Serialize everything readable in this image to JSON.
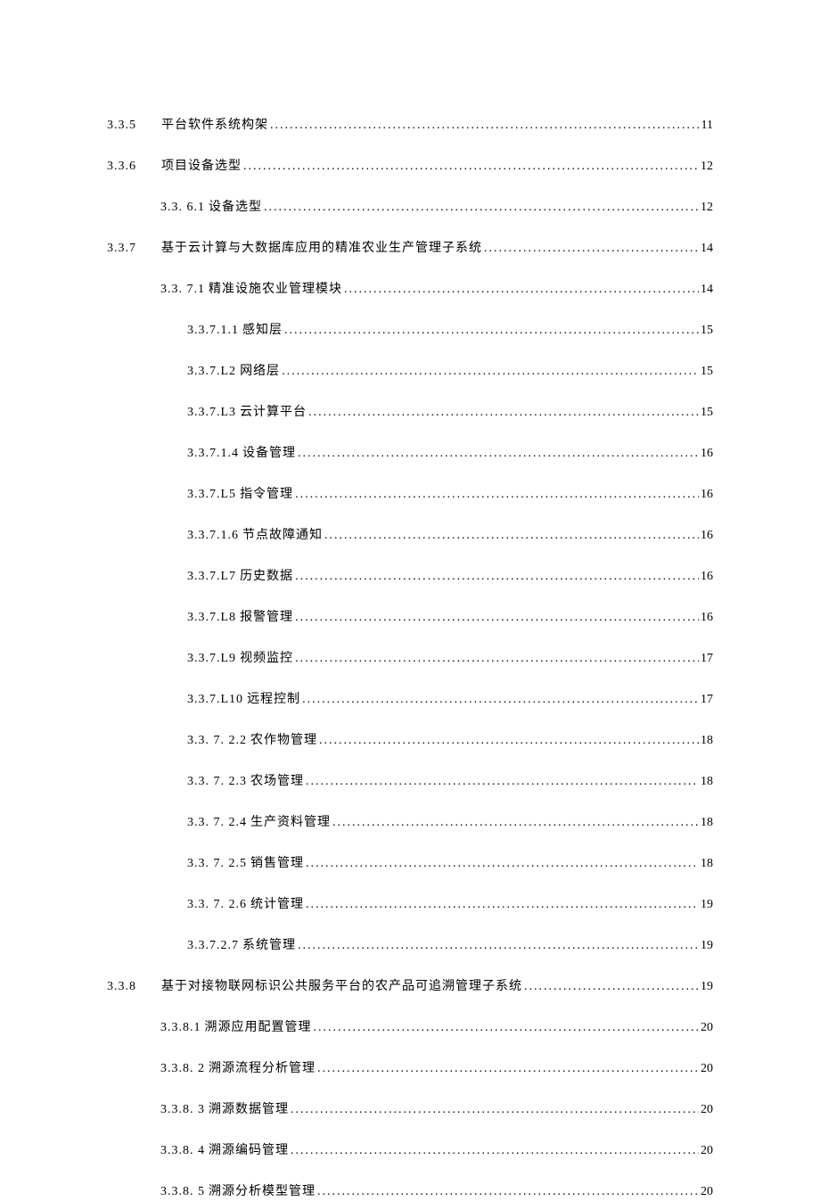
{
  "toc": [
    {
      "indent": 0,
      "number": "3.3.5",
      "numberClass": "gap-after-number",
      "title": "平台软件系统构架",
      "page": "11"
    },
    {
      "indent": 0,
      "number": "3.3.6",
      "numberClass": "gap-after-number",
      "title": "项目设备选型",
      "page": "12"
    },
    {
      "indent": 1,
      "number": "3.3. 6.1",
      "numberClass": "gap-small",
      "title": "设备选型",
      "page": "12"
    },
    {
      "indent": 0,
      "number": "3.3.7",
      "numberClass": "gap-after-number",
      "title": "基于云计算与大数据库应用的精准农业生产管理子系统",
      "page": "14"
    },
    {
      "indent": 1,
      "number": "3.3. 7.1",
      "numberClass": "gap-small",
      "title": "精准设施农业管理模块",
      "page": "14"
    },
    {
      "indent": 2,
      "number": "3.3.7.1.1",
      "numberClass": "gap-small",
      "title": "感知层",
      "page": "15"
    },
    {
      "indent": 2,
      "number": "3.3.7.L2",
      "numberClass": "gap-small",
      "title": "网络层",
      "page": "15"
    },
    {
      "indent": 2,
      "number": "3.3.7.L3",
      "numberClass": "gap-small",
      "title": "云计算平台",
      "page": "15"
    },
    {
      "indent": 2,
      "number": "3.3.7.1.4",
      "numberClass": "gap-small",
      "title": "设备管理",
      "page": "16"
    },
    {
      "indent": 2,
      "number": "3.3.7.L5",
      "numberClass": "gap-small",
      "title": "指令管理",
      "page": "16"
    },
    {
      "indent": 2,
      "number": "3.3.7.1.6",
      "numberClass": "gap-small",
      "title": "节点故障通知",
      "page": "16"
    },
    {
      "indent": 2,
      "number": "3.3.7.L7",
      "numberClass": "gap-small",
      "title": "历史数据",
      "page": "16"
    },
    {
      "indent": 2,
      "number": "3.3.7.L8",
      "numberClass": "gap-small",
      "title": "报警管理",
      "page": "16"
    },
    {
      "indent": 2,
      "number": "3.3.7.L9",
      "numberClass": "gap-small",
      "title": "视频监控",
      "page": "17"
    },
    {
      "indent": 2,
      "number": "3.3.7.L10",
      "numberClass": "gap-small",
      "title": "远程控制",
      "page": "17"
    },
    {
      "indent": 2,
      "number": "3.3. 7. 2.2",
      "numberClass": "gap-small",
      "title": "农作物管理",
      "page": "18"
    },
    {
      "indent": 2,
      "number": "3.3. 7. 2.3",
      "numberClass": "gap-small",
      "title": "农场管理",
      "page": "18"
    },
    {
      "indent": 2,
      "number": "3.3. 7. 2.4",
      "numberClass": "gap-small",
      "title": "生产资料管理",
      "page": "18"
    },
    {
      "indent": 2,
      "number": "3.3. 7. 2.5",
      "numberClass": "gap-small",
      "title": "销售管理",
      "page": "18"
    },
    {
      "indent": 2,
      "number": "3.3. 7. 2.6",
      "numberClass": "gap-small",
      "title": "统计管理",
      "page": "19"
    },
    {
      "indent": 2,
      "number": "3.3.7.2.7",
      "numberClass": "gap-small",
      "title": "系统管理",
      "page": "19"
    },
    {
      "indent": 0,
      "number": "3.3.8",
      "numberClass": "gap-after-number",
      "title": "基于对接物联网标识公共服务平台的农产品可追溯管理子系统",
      "page": "19"
    },
    {
      "indent": 1,
      "number": "3.3.8.1",
      "numberClass": "gap-small",
      "title": "溯源应用配置管理",
      "page": "20"
    },
    {
      "indent": 1,
      "number": "3.3.8. 2 ",
      "numberClass": "gap-small",
      "title": "溯源流程分析管理",
      "page": "20"
    },
    {
      "indent": 1,
      "number": "3.3.8. 3 ",
      "numberClass": "gap-small",
      "title": "溯源数据管理",
      "page": "20"
    },
    {
      "indent": 1,
      "number": "3.3.8. 4 ",
      "numberClass": "gap-small",
      "title": "溯源编码管理",
      "page": "20"
    },
    {
      "indent": 1,
      "number": "3.3.8. 5 ",
      "numberClass": "gap-small",
      "title": "溯源分析模型管理",
      "page": "20"
    }
  ]
}
